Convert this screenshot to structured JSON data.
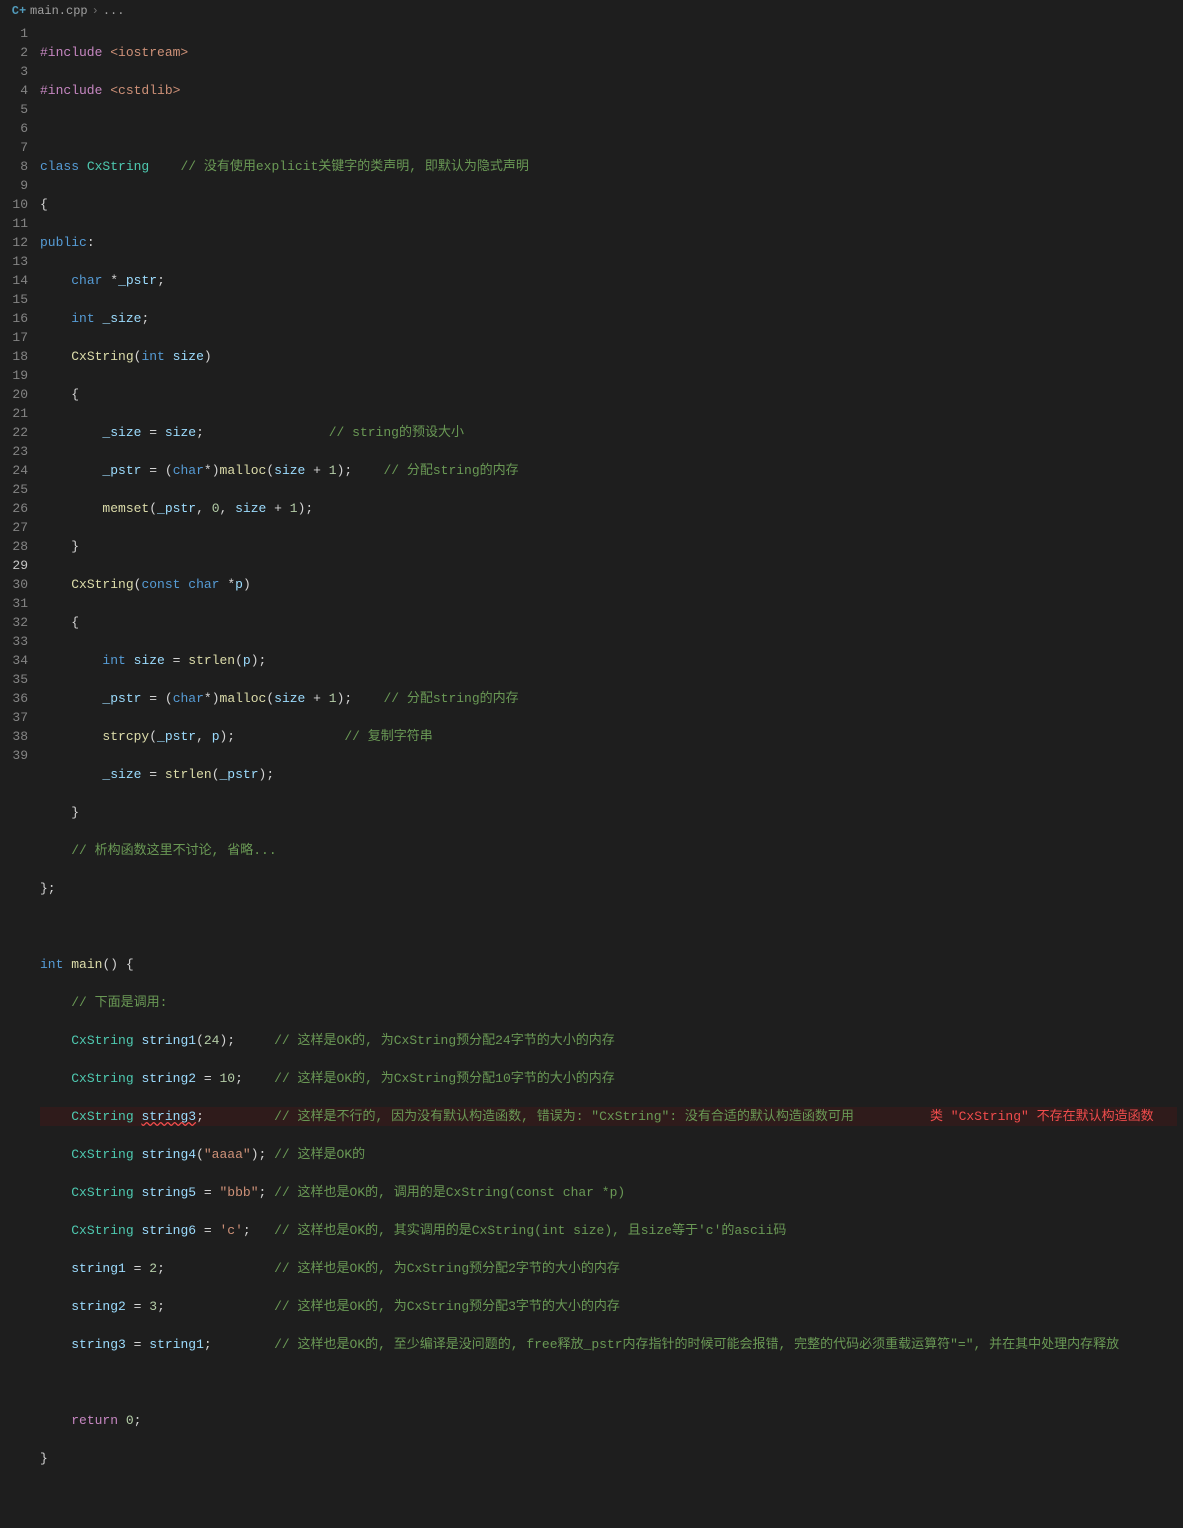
{
  "breadcrumb": {
    "icon": "C+",
    "file": "main.cpp",
    "sep": "›",
    "rest": "..."
  },
  "lines": {
    "count": 39,
    "active": 29
  },
  "code": {
    "l1": {
      "pp": "#include",
      "str": " <iostream>"
    },
    "l2": {
      "pp": "#include",
      "str": " <cstdlib>"
    },
    "l4_kw": "class",
    "l4_type": "CxString",
    "l4_com": "// 没有使用explicit关键字的类声明, 即默认为隐式声明",
    "l6_kw": "public",
    "l7_kw": "char",
    "l7_var": "_pstr",
    "l8_kw": "int",
    "l8_var": "_size",
    "l9_ctor": "CxString",
    "l9_kw": "int",
    "l9_param": "size",
    "l11_var1": "_size",
    "l11_var2": "size",
    "l11_com": "// string的预设大小",
    "l12_var": "_pstr",
    "l12_kw": "char",
    "l12_fn": "malloc",
    "l12_size": "size",
    "l12_num": "1",
    "l12_com": "// 分配string的内存",
    "l13_fn": "memset",
    "l13_v1": "_pstr",
    "l13_n0": "0",
    "l13_v2": "size",
    "l13_n1": "1",
    "l15_ctor": "CxString",
    "l15_kw1": "const",
    "l15_kw2": "char",
    "l15_param": "p",
    "l17_kw": "int",
    "l17_var": "size",
    "l17_fn": "strlen",
    "l17_param": "p",
    "l18_var": "_pstr",
    "l18_kw": "char",
    "l18_fn": "malloc",
    "l18_size": "size",
    "l18_num": "1",
    "l18_com": "// 分配string的内存",
    "l19_fn": "strcpy",
    "l19_v1": "_pstr",
    "l19_v2": "p",
    "l19_com": "// 复制字符串",
    "l20_var1": "_size",
    "l20_fn": "strlen",
    "l20_v2": "_pstr",
    "l22_com": "// 析构函数这里不讨论, 省略...",
    "l25_kw": "int",
    "l25_fn": "main",
    "l26_com": "// 下面是调用:",
    "l27_type": "CxString",
    "l27_var": "string1",
    "l27_num": "24",
    "l27_com": "// 这样是OK的, 为CxString预分配24字节的大小的内存",
    "l28_type": "CxString",
    "l28_var": "string2",
    "l28_num": "10",
    "l28_com": "// 这样是OK的, 为CxString预分配10字节的大小的内存",
    "l29_type": "CxString",
    "l29_var": "string3",
    "l29_com": "// 这样是不行的, 因为没有默认构造函数, 错误为: \"CxString\": 没有合适的默认构造函数可用",
    "l29_err": "类 \"CxString\" 不存在默认构造函数",
    "l30_type": "CxString",
    "l30_var": "string4",
    "l30_str": "\"aaaa\"",
    "l30_com": "// 这样是OK的",
    "l31_type": "CxString",
    "l31_var": "string5",
    "l31_str": "\"bbb\"",
    "l31_com": "// 这样也是OK的, 调用的是CxString(const char *p)",
    "l32_type": "CxString",
    "l32_var": "string6",
    "l32_str": "'c'",
    "l32_com": "// 这样也是OK的, 其实调用的是CxString(int size), 且size等于'c'的ascii码",
    "l33_v1": "string1",
    "l33_num": "2",
    "l33_com": "// 这样也是OK的, 为CxString预分配2字节的大小的内存",
    "l34_v1": "string2",
    "l34_num": "3",
    "l34_com": "// 这样也是OK的, 为CxString预分配3字节的大小的内存",
    "l35_v1": "string3",
    "l35_v2": "string1",
    "l35_com": "// 这样也是OK的, 至少编译是没问题的, free释放_pstr内存指针的时候可能会报错, 完整的代码必须重载运算符\"=\", 并在其中处理内存释放",
    "l37_kw": "return",
    "l37_num": "0"
  }
}
